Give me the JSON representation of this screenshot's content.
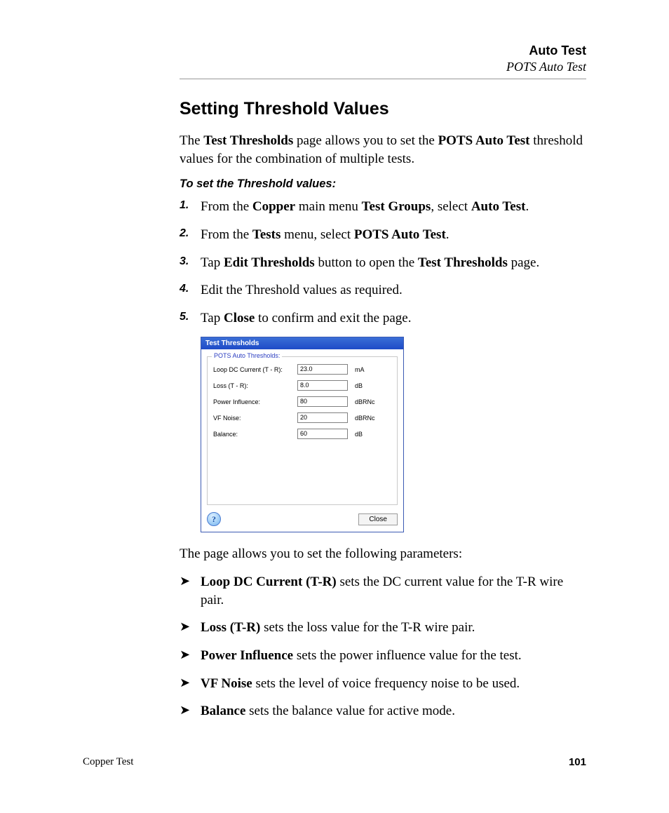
{
  "header": {
    "title": "Auto Test",
    "subtitle": "POTS Auto Test"
  },
  "h1": "Setting Threshold Values",
  "lead": {
    "a": "The ",
    "b": "Test Thresholds",
    "c": " page allows you to set the ",
    "d": "POTS Auto Test",
    "e": " threshold values for the combination of multiple tests."
  },
  "subhead": "To set the Threshold values:",
  "steps": [
    {
      "n": "1.",
      "a": "From the ",
      "b": "Copper",
      "c": " main menu ",
      "d": "Test Groups",
      "e": ", select ",
      "f": "Auto Test",
      "g": "."
    },
    {
      "n": "2.",
      "a": "From the ",
      "b": "Tests",
      "c": " menu, select ",
      "d": "POTS Auto Test",
      "e": "."
    },
    {
      "n": "3.",
      "a": "Tap ",
      "b": "Edit Thresholds",
      "c": " button to open the ",
      "d": "Test Thresholds",
      "e": " page."
    },
    {
      "n": "4.",
      "a": "Edit the Threshold values as required."
    },
    {
      "n": "5.",
      "a": "Tap ",
      "b": "Close",
      "c": " to confirm and exit the page."
    }
  ],
  "dialog": {
    "title": "Test Thresholds",
    "group": "POTS Auto Thresholds:",
    "rows": [
      {
        "label": "Loop DC Current (T - R):",
        "value": "23.0",
        "unit": "mA"
      },
      {
        "label": "Loss (T - R):",
        "value": "8.0",
        "unit": "dB"
      },
      {
        "label": "Power Influence:",
        "value": "80",
        "unit": "dBRNc"
      },
      {
        "label": "VF Noise:",
        "value": "20",
        "unit": "dBRNc"
      },
      {
        "label": "Balance:",
        "value": "60",
        "unit": "dB"
      }
    ],
    "help": "?",
    "close": "Close"
  },
  "after": "The page allows you to set the following parameters:",
  "params": [
    {
      "b": "Loop DC Current (T-R)",
      "t": " sets the DC current value for the T-R wire pair."
    },
    {
      "b": "Loss (T-R)",
      "t": " sets the loss value for the T-R wire pair."
    },
    {
      "b": "Power Influence",
      "t": " sets the power influence value for the test."
    },
    {
      "b": "VF Noise",
      "t": " sets the level of voice frequency noise to be used."
    },
    {
      "b": "Balance",
      "t": " sets the balance value for active mode."
    }
  ],
  "footer": {
    "left": "Copper Test",
    "right": "101"
  },
  "arrow": "➤"
}
